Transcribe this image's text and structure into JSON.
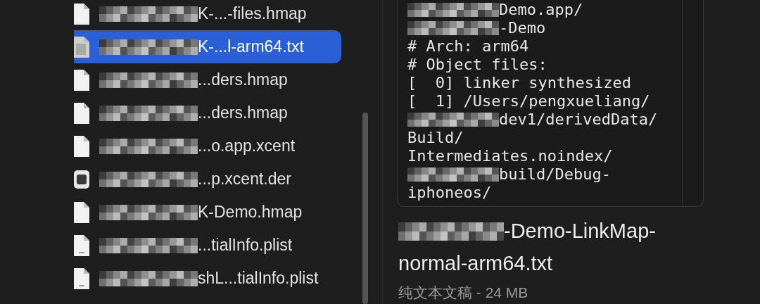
{
  "files": [
    {
      "name": "K-...-files.hmap",
      "kind": "document",
      "selected": false
    },
    {
      "name": "K-...l-arm64.txt",
      "kind": "text",
      "selected": true
    },
    {
      "name": "...ders.hmap",
      "kind": "document",
      "selected": false
    },
    {
      "name": "...ders.hmap",
      "kind": "document",
      "selected": false
    },
    {
      "name": "...o.app.xcent",
      "kind": "document",
      "selected": false
    },
    {
      "name": "...p.xcent.der",
      "kind": "certificate",
      "selected": false
    },
    {
      "name": "K-Demo.hmap",
      "kind": "document",
      "selected": false
    },
    {
      "name": "...tialInfo.plist",
      "kind": "plist",
      "selected": false
    },
    {
      "name": "shL...tialInfo.plist",
      "kind": "plist",
      "selected": false
    }
  ],
  "preview": {
    "lines": [
      {
        "text": "Demo.app/",
        "redacted": true
      },
      {
        "text": "-Demo",
        "redacted": true
      },
      {
        "text": "# Arch: arm64",
        "redacted": false
      },
      {
        "text": "# Object files:",
        "redacted": false
      },
      {
        "text": "[  0] linker synthesized",
        "redacted": false
      },
      {
        "text": "[  1] /Users/pengxueliang/",
        "redacted": false
      },
      {
        "text": "dev1/derivedData/",
        "redacted": true
      },
      {
        "text": "Build/",
        "redacted": false
      },
      {
        "text": "Intermediates.noindex/",
        "redacted": false
      },
      {
        "text": "build/Debug-",
        "redacted": true
      },
      {
        "text": "iphoneos/",
        "redacted": false
      }
    ],
    "filename_lines": [
      "-Demo-LinkMap-",
      "normal-arm64.txt"
    ],
    "kind_size": "纯文本文稿 - 24 MB"
  }
}
